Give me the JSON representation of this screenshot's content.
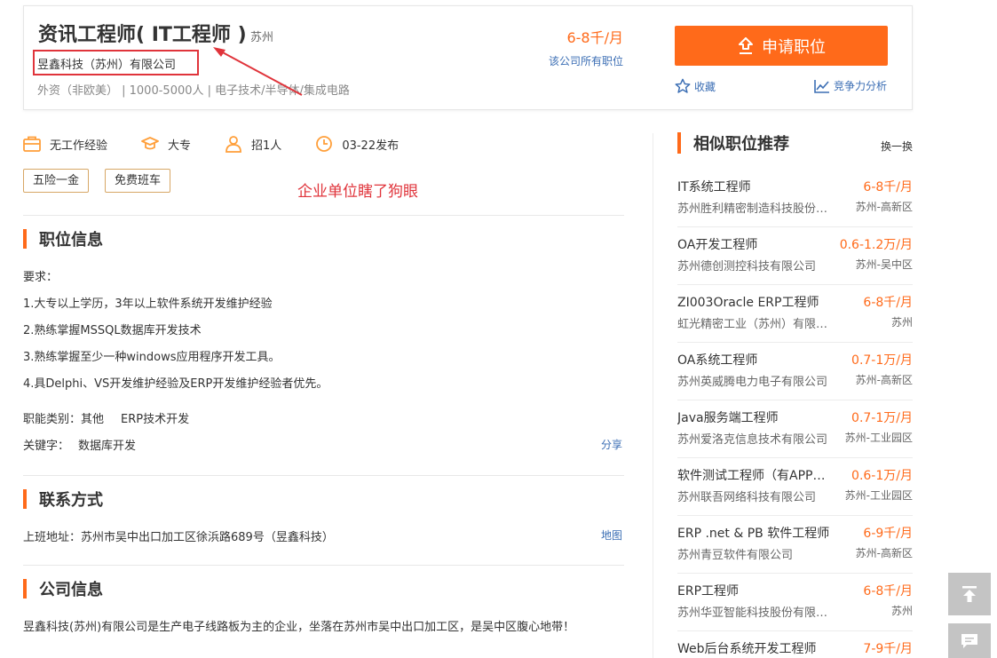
{
  "header": {
    "title": "资讯工程师( IT工程师 )",
    "city": "苏州",
    "company": "昱鑫科技（苏州）有限公司",
    "meta": "外资（非欧美）  |  1000-5000人  |  电子技术/半导体/集成电路",
    "salary": "6-8千/月",
    "all_jobs_link": "该公司所有职位",
    "apply_label": "申请职位",
    "favorite_label": "收藏",
    "competitiveness_label": "竞争力分析",
    "accent_color": "#ff6a1a"
  },
  "annotation": {
    "note": "企业单位瞎了狗眼",
    "color": "#e0343b"
  },
  "requirements": {
    "experience": "无工作经验",
    "education": "大专",
    "headcount": "招1人",
    "published": "03-22发布"
  },
  "tags": [
    "五险一金",
    "免费班车"
  ],
  "job_info": {
    "title": "职位信息",
    "lines": [
      "要求：",
      "1.大专以上学历，3年以上软件系统开发维护经验",
      "2.熟练掌握MSSQL数据库开发技术",
      "3.熟练掌握至少一种windows应用程序开发工具。",
      "4.具Delphi、VS开发维护经验及ERP开发维护经验者优先。"
    ],
    "category_label": "职能类别：",
    "categories": [
      "其他",
      "ERP技术开发"
    ],
    "keyword_label": "关键字：",
    "keyword": "数据库开发",
    "share_label": "分享"
  },
  "contact": {
    "title": "联系方式",
    "address": "上班地址：苏州市吴中出口加工区徐浜路689号（昱鑫科技）",
    "map_label": "地图"
  },
  "company_info": {
    "title": "公司信息",
    "text": "昱鑫科技(苏州)有限公司是生产电子线路板为主的企业，坐落在苏州市吴中出口加工区，是吴中区腹心地带！"
  },
  "recommend": {
    "title": "相似职位推荐",
    "refresh_label": "换一换",
    "items": [
      {
        "title": "IT系统工程师",
        "salary": "6-8千/月",
        "company": "苏州胜利精密制造科技股份有限公司",
        "area": "苏州-高新区"
      },
      {
        "title": "OA开发工程师",
        "salary": "0.6-1.2万/月",
        "company": "苏州德创测控科技有限公司",
        "area": "苏州-吴中区"
      },
      {
        "title": "ZI003Oracle ERP工程师",
        "salary": "6-8千/月",
        "company": "虹光精密工业（苏州）有限公司",
        "area": "苏州"
      },
      {
        "title": "OA系统工程师",
        "salary": "0.7-1万/月",
        "company": "苏州英威腾电力电子有限公司",
        "area": "苏州-高新区"
      },
      {
        "title": "Java服务端工程师",
        "salary": "0.7-1万/月",
        "company": "苏州爱洛克信息技术有限公司",
        "area": "苏州-工业园区"
      },
      {
        "title": "软件测试工程师（有APP测试经验）",
        "salary": "0.6-1万/月",
        "company": "苏州联吾网络科技有限公司",
        "area": "苏州-工业园区"
      },
      {
        "title": "ERP .net & PB 软件工程师",
        "salary": "6-9千/月",
        "company": "苏州青豆软件有限公司",
        "area": "苏州-高新区"
      },
      {
        "title": "ERP工程师",
        "salary": "6-8千/月",
        "company": "苏州华亚智能科技股份有限公司",
        "area": "苏州"
      },
      {
        "title": "Web后台系统开发工程师",
        "salary": "7-9千/月",
        "company": "",
        "area": ""
      }
    ]
  },
  "float_buttons": {
    "top_icon": "arrow-up-bar-icon",
    "feedback_icon": "chat-bubble-icon"
  }
}
